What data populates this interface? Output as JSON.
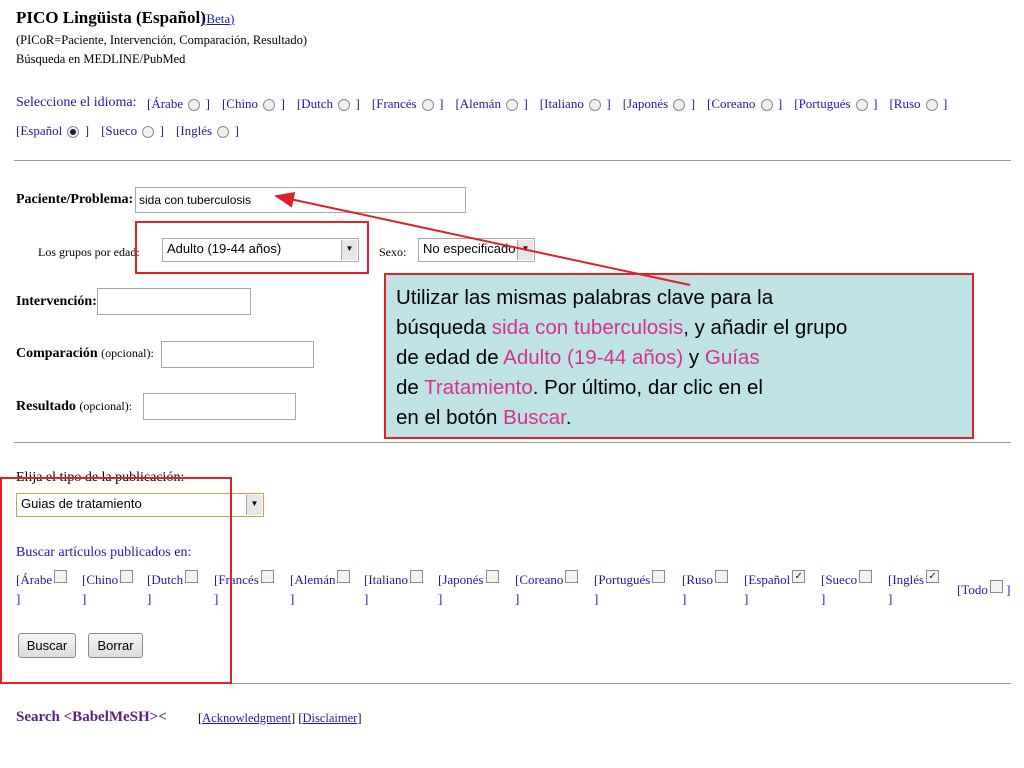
{
  "header": {
    "title": "PICO Lingüista (Español)",
    "beta_link": "(Beta)",
    "subtitle1": "(PICoR=Paciente, Intervención, Comparación, Resultado)",
    "subtitle2": "Búsqueda en MEDLINE/PubMed"
  },
  "language_select": {
    "label": "Seleccione el idioma:",
    "row1": [
      "[Árabe",
      "[Chino",
      "[Dutch",
      "[Francés",
      "[Alemán",
      "[Italiano",
      "[Japonés",
      "[Coreano",
      "[Portugués",
      "[Ruso"
    ],
    "row2": [
      "[Español",
      "[Sueco",
      "[Inglés"
    ],
    "close": "]",
    "selected": "[Español"
  },
  "form": {
    "patient_label": "Paciente/Problema:",
    "patient_value": "sida con tuberculosis",
    "age_label": "Los grupos por edad:",
    "age_value": "Adulto (19-44 años)",
    "sex_label": "Sexo:",
    "sex_value": "No especificado",
    "intervention_label": "Intervención:",
    "comparison_label": "Comparación",
    "comparison_opt": "(opcional):",
    "result_label": "Resultado",
    "result_opt": "(opcional):"
  },
  "publication": {
    "type_label": "Elija el tipo de la publicación:",
    "type_value": "Guias de tratamiento",
    "search_in_label": "Buscar artículos publicados en:",
    "languages": [
      {
        "label": "[Árabe",
        "checked": false
      },
      {
        "label": "[Chino",
        "checked": false
      },
      {
        "label": "[Dutch",
        "checked": false
      },
      {
        "label": "[Francés",
        "checked": false
      },
      {
        "label": "[Alemán",
        "checked": false
      },
      {
        "label": "[Italiano",
        "checked": false
      },
      {
        "label": "[Japonés",
        "checked": false
      },
      {
        "label": "[Coreano",
        "checked": false
      },
      {
        "label": "[Portugués",
        "checked": false
      },
      {
        "label": "[Ruso",
        "checked": false
      },
      {
        "label": "[Español",
        "checked": true
      },
      {
        "label": "[Sueco",
        "checked": false
      },
      {
        "label": "[Inglés",
        "checked": true
      }
    ],
    "close": "]",
    "all_label": "[Todo",
    "search_button": "Buscar",
    "clear_button": "Borrar"
  },
  "footer": {
    "search_label": "Search <BabelMeSH><",
    "ack_link": "Acknowledgment",
    "disclaimer_link": "Disclaimer",
    "bracket_open": "[",
    "bracket_mid": "] [",
    "bracket_close": "]"
  },
  "callout": {
    "t1": "Utilizar las mismas palabras clave para la",
    "t2": "búsqueda ",
    "h1": "sida con tuberculosis",
    "t3": ", y añadir el grupo",
    "t4": "de edad de ",
    "h2": "Adulto (19-44 años)",
    "t5": " y ",
    "h3": "Guías",
    "t6": "de ",
    "h4": "Tratamiento",
    "t7": ". Por último, dar clic en el",
    "t8": "en el botón ",
    "h5": "Buscar",
    "t9": "."
  },
  "colors": {
    "link": "#1a1aa6",
    "highlight": "#d6318f",
    "annotation_red": "#e0202a",
    "callout_bg": "#bfe3e4"
  }
}
